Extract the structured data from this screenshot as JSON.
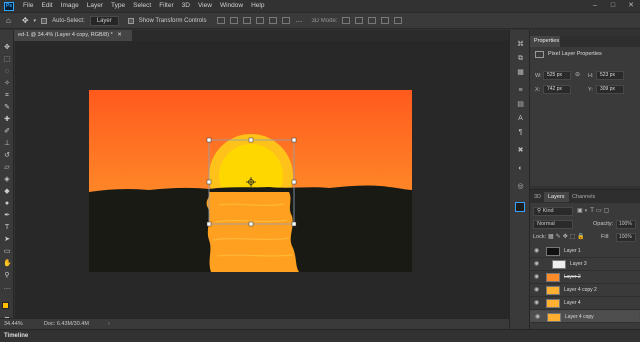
{
  "menubar": {
    "items": [
      "File",
      "Edit",
      "Image",
      "Layer",
      "Type",
      "Select",
      "Filter",
      "3D",
      "View",
      "Window",
      "Help"
    ],
    "logo": "Ps"
  },
  "options": {
    "auto_select_label": "Auto-Select:",
    "auto_select_value": "Layer",
    "transform_label": "Show Transform Controls",
    "mode_label": "3D Mode:"
  },
  "document": {
    "tab_title": "ed-1 @ 34.4% (Layer 4 copy, RGB/8) *",
    "zoom": "34.44%",
    "doc_size": "Doc: 6.43M/30.4M"
  },
  "properties": {
    "tab": "Properties",
    "subtitle": "Pixel Layer Properties",
    "w": "525 px",
    "h": "523 px",
    "x": "742 px",
    "y": "309 px",
    "w_label": "W:",
    "h_label": "H:",
    "x_label": "X:",
    "y_label": "Y:"
  },
  "layers_panel": {
    "tabs": [
      "3D",
      "Layers",
      "Channels"
    ],
    "active_tab": "Layers",
    "filter": "Kind",
    "blend_mode": "Normal",
    "opacity_label": "Opacity:",
    "opacity": "100%",
    "lock_label": "Lock:",
    "fill_label": "Fill:",
    "fill": "100%",
    "layers": [
      {
        "name": "Layer 1",
        "selected": false
      },
      {
        "name": "Layer 3",
        "selected": false
      },
      {
        "name": "Layer 2",
        "selected": false
      },
      {
        "name": "Layer 4 copy 2",
        "selected": false
      },
      {
        "name": "Layer 4",
        "selected": false
      },
      {
        "name": "Layer 4 copy",
        "selected": true
      }
    ]
  },
  "timeline": {
    "label": "Timeline"
  },
  "colors": {
    "sky_top": "#ff5a1e",
    "sky_bottom": "#ff8a28",
    "sun": "#ffd700",
    "ground": "#1a1a14",
    "reflection": "#ffa020"
  }
}
